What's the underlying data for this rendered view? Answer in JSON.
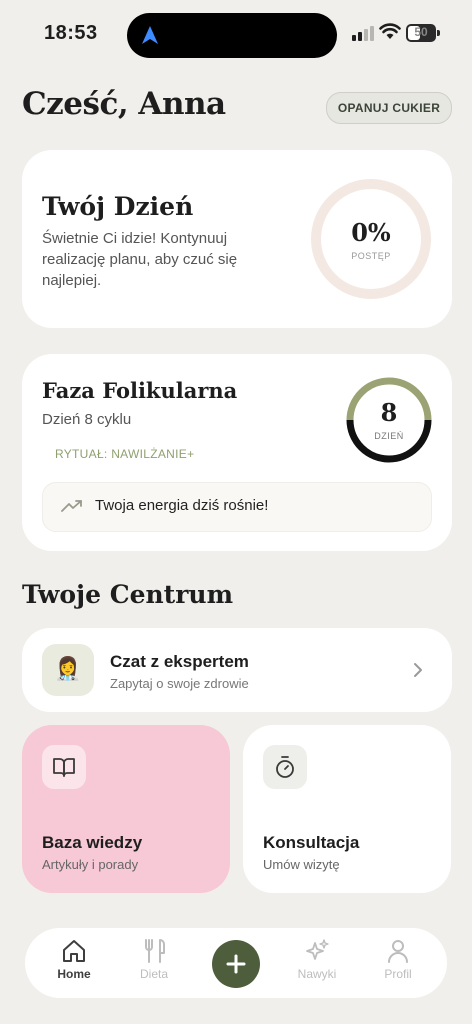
{
  "status_bar": {
    "time": "18:53",
    "battery": "50"
  },
  "header": {
    "greeting": "Cześć, Anna",
    "sugar_button": "OPANUJ CUKIER"
  },
  "day_card": {
    "title": "Twój Dzień",
    "description": "Świetnie Ci idzie! Kontynuuj realizację planu, aby czuć się najlepiej.",
    "progress_value": "0%",
    "progress_label": "POSTĘP",
    "progress": 0
  },
  "phase_card": {
    "title": "Faza Folikularna",
    "cycle_day": "Dzień 8 cyklu",
    "ritual": "RYTUAŁ: NAWILŻANIE+",
    "day_number": "8",
    "day_label": "DZIEŃ",
    "energy_message": "Twoja energia dziś rośnie!"
  },
  "hub": {
    "title": "Twoje Centrum",
    "chat": {
      "title": "Czat z ekspertem",
      "subtitle": "Zapytaj o swoje zdrowie",
      "avatar_emoji": "👩‍⚕️"
    },
    "tiles": [
      {
        "title": "Baza wiedzy",
        "subtitle": "Artykuły i porady",
        "icon": "book-icon",
        "color": "#F7C8D6"
      },
      {
        "title": "Konsultacja",
        "subtitle": "Umów wizytę",
        "icon": "stopwatch-icon",
        "color": "#FFFFFF"
      }
    ]
  },
  "nav": {
    "items": [
      {
        "label": "Home",
        "icon": "home-icon",
        "active": true
      },
      {
        "label": "Dieta",
        "icon": "utensils-icon",
        "active": false
      },
      {
        "label": "Nawyki",
        "icon": "sparkles-icon",
        "active": false
      },
      {
        "label": "Profil",
        "icon": "user-icon",
        "active": false
      }
    ],
    "add_icon": "plus-icon"
  },
  "colors": {
    "background": "#F1EFEB",
    "accent_green": "#4E5E3C",
    "pink": "#F7C8D6",
    "ring_olive": "#9BA374",
    "ritual_green": "#8FA070"
  }
}
